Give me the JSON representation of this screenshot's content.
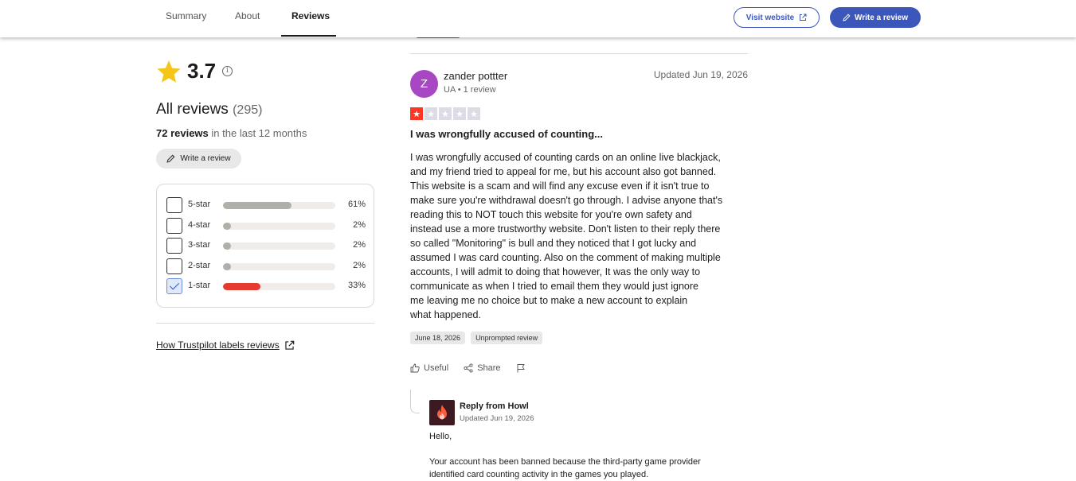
{
  "nav": {
    "tabs": [
      {
        "label": "Summary"
      },
      {
        "label": "About"
      },
      {
        "label": "Reviews"
      }
    ],
    "visit_website": "Visit website",
    "write_review": "Write a review"
  },
  "summary": {
    "rating": "3.7",
    "all_reviews_label": "All reviews",
    "all_reviews_count": "(295)",
    "recent_count": "72 reviews",
    "recent_suffix": "in the last 12 months",
    "write_review": "Write a review",
    "filters": [
      {
        "label": "5-star",
        "percent": "61%",
        "fraction": 0.61,
        "checked": false
      },
      {
        "label": "4-star",
        "percent": "2%",
        "fraction": 0.02,
        "checked": false
      },
      {
        "label": "3-star",
        "percent": "2%",
        "fraction": 0.02,
        "checked": false
      },
      {
        "label": "2-star",
        "percent": "2%",
        "fraction": 0.02,
        "checked": false
      },
      {
        "label": "1-star",
        "percent": "33%",
        "fraction": 0.33,
        "checked": true
      }
    ],
    "labels_link": "How Trustpilot labels reviews"
  },
  "review": {
    "avatar_initial": "Z",
    "author": "zander pottter",
    "author_meta": "UA • 1 review",
    "updated": "Updated Jun 19, 2026",
    "stars": 1,
    "title": "I was wrongfully accused of counting...",
    "body_lines": [
      "I was wrongfully accused of counting cards on an online live blackjack,",
      "and my friend tried to appeal for me, but his account also got banned.",
      "This website is a scam and will find any excuse even if it isn't true to",
      "make sure you're withdrawal doesn't go through. I advise anyone that's",
      "reading this to NOT touch this website for you're own safety and",
      "instead use a more trustworthy website. Don't listen to their reply there",
      "so called \"Monitoring\" is bull and they noticed that I got lucky and",
      "assumed I was card counting. Also on the comment of making multiple",
      "accounts, I will admit to doing that however, It was the only way to",
      "communicate as when I tried to email them they would just ignore",
      "me leaving me no choice but to make a new account to explain",
      "what happened."
    ],
    "date_chip": "June 18, 2026",
    "type_chip": "Unprompted review",
    "useful": "Useful",
    "share": "Share"
  },
  "reply": {
    "from": "Reply from Howl",
    "updated": "Updated Jun 19, 2026",
    "greeting": "Hello,",
    "text_lines": [
      "Your account has been banned because the third-party game provider",
      "identified card counting activity in the games you played."
    ]
  },
  "colors": {
    "brand_blue": "#3c57bc",
    "star_red": "#ff3722",
    "bar_grey": "#b0b0ab",
    "bar_red": "#e63a2e",
    "avatar_purple": "#a847c4",
    "gold_star": "#f5c518"
  }
}
